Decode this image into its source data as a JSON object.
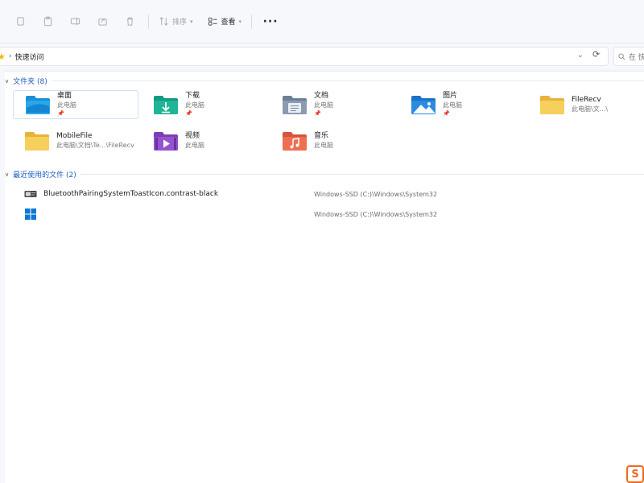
{
  "toolbar": {
    "sort_label": "排序",
    "view_label": "查看",
    "more_label": "···"
  },
  "address": {
    "breadcrumb": "快速访问",
    "search_placeholder": "在 快"
  },
  "folders_section": {
    "title": "文件夹 (8)",
    "items": [
      {
        "name": "桌面",
        "sub": "此电脑",
        "pinned": true,
        "icon": "desktop-folder-icon"
      },
      {
        "name": "下载",
        "sub": "此电脑",
        "pinned": true,
        "icon": "downloads-folder-icon"
      },
      {
        "name": "文档",
        "sub": "此电脑",
        "pinned": true,
        "icon": "documents-folder-icon"
      },
      {
        "name": "图片",
        "sub": "此电脑",
        "pinned": true,
        "icon": "pictures-folder-icon"
      },
      {
        "name": "FileRecv",
        "sub": "此电脑\\文...\\",
        "pinned": false,
        "icon": "folder-icon"
      },
      {
        "name": "MobileFile",
        "sub": "此电脑\\文档\\Te...\\FileRecv",
        "pinned": false,
        "icon": "folder-icon"
      },
      {
        "name": "视频",
        "sub": "此电脑",
        "pinned": false,
        "icon": "videos-folder-icon"
      },
      {
        "name": "音乐",
        "sub": "此电脑",
        "pinned": false,
        "icon": "music-folder-icon"
      }
    ]
  },
  "recent_section": {
    "title": "最近使用的文件 (2)",
    "items": [
      {
        "name": "BluetoothPairingSystemToastIcon.contrast-black",
        "path": "Windows-SSD (C:)\\Windows\\System32",
        "icon": "image-file-icon"
      },
      {
        "name": "",
        "path": "Windows-SSD (C:)\\Windows\\System32",
        "icon": "windows-logo-icon"
      }
    ]
  },
  "colors": {
    "accent": "#1f5fbf",
    "folder_yellow": "#f7cf5c",
    "star": "#f2b90a",
    "watermark": "#ee6a1f"
  },
  "watermark": {
    "text": "S"
  }
}
